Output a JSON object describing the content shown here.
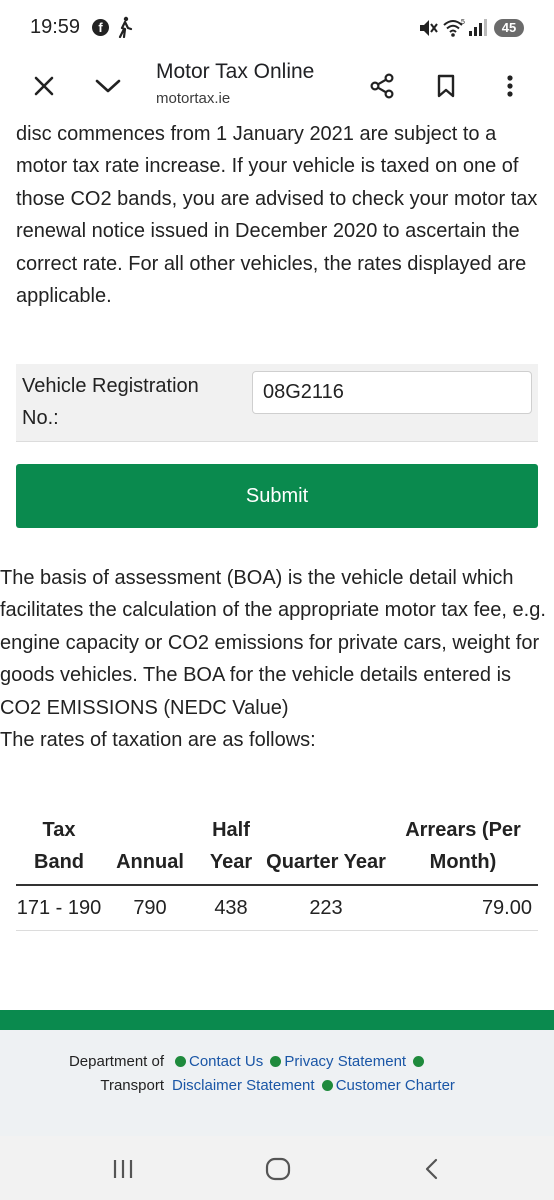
{
  "status_bar": {
    "time": "19:59",
    "battery": "45",
    "icons": [
      "facebook-icon",
      "walking-icon",
      "mute-icon",
      "wifi-icon",
      "signal-icon",
      "battery-icon"
    ]
  },
  "toolbar": {
    "title": "Motor Tax Online",
    "url": "motortax.ie",
    "icons": [
      "close-icon",
      "chevron-down-icon",
      "share-icon",
      "bookmark-icon",
      "more-vert-icon"
    ]
  },
  "content": {
    "intro_text": "disc commences from 1 January 2021 are subject to a motor tax rate increase. If your vehicle is taxed on one of those CO2 bands, you are advised to check your motor tax renewal notice issued in December 2020 to ascertain the correct rate. For all other vehicles, the rates displayed are applicable.",
    "form": {
      "reg_label": "Vehicle Registration No.:",
      "reg_value": "08G2116",
      "submit_label": "Submit"
    },
    "boa_text": "The basis of assessment (BOA) is the vehicle detail which facilitates the calculation of the appropriate motor tax fee, e.g. engine capacity or CO2 emissions for private cars, weight for goods vehicles. The BOA for the vehicle details entered is CO2 EMISSIONS (NEDC Value)",
    "rates_intro": "The rates of taxation are as follows:",
    "rates_table": {
      "headers": [
        "Tax Band",
        "Annual",
        "Half Year",
        "Quarter Year",
        "Arrears (Per Month)"
      ],
      "rows": [
        [
          "171 - 190",
          "790",
          "438",
          "223",
          "79.00"
        ]
      ]
    }
  },
  "footer": {
    "department": "Department of Transport",
    "links": [
      "Contact Us",
      "Privacy Statement",
      "Disclaimer Statement",
      "Customer Charter"
    ],
    "colors": {
      "stripe": "#0a8a4e",
      "dot": "#1e8a3c",
      "link": "#1a56a6"
    }
  },
  "nav_bar": {
    "icons": [
      "recent-apps-icon",
      "home-icon",
      "back-icon"
    ]
  }
}
